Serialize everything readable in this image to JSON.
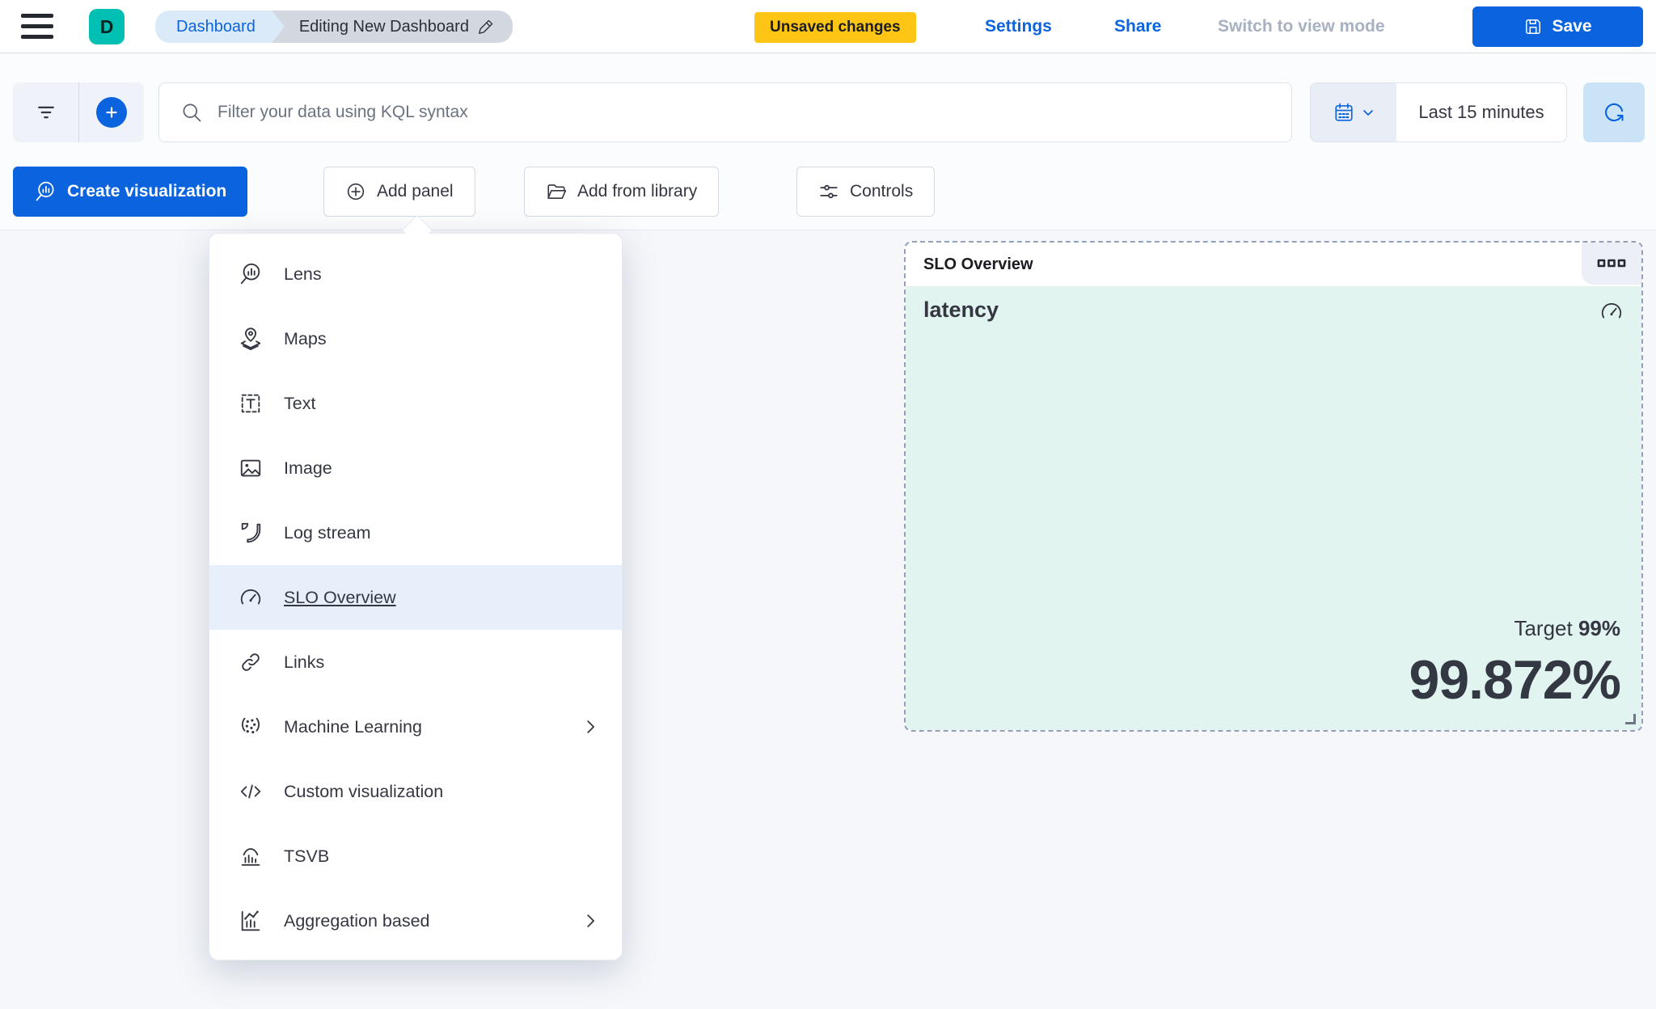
{
  "header": {
    "avatar_initial": "D",
    "breadcrumbs": [
      {
        "label": "Dashboard"
      },
      {
        "label": "Editing New Dashboard"
      }
    ],
    "unsaved_badge": "Unsaved changes",
    "settings_label": "Settings",
    "share_label": "Share",
    "view_mode_label": "Switch to view mode",
    "save_label": "Save"
  },
  "filter_bar": {
    "search_placeholder": "Filter your data using KQL syntax",
    "time_range": "Last 15 minutes"
  },
  "toolbar": {
    "create_visualization_label": "Create visualization",
    "add_panel_label": "Add panel",
    "add_from_library_label": "Add from library",
    "controls_label": "Controls"
  },
  "add_panel_menu": {
    "items": [
      {
        "label": "Lens",
        "icon": "lens-icon",
        "highlighted": false,
        "has_submenu": false
      },
      {
        "label": "Maps",
        "icon": "maps-icon",
        "highlighted": false,
        "has_submenu": false
      },
      {
        "label": "Text",
        "icon": "text-icon",
        "highlighted": false,
        "has_submenu": false
      },
      {
        "label": "Image",
        "icon": "image-icon",
        "highlighted": false,
        "has_submenu": false
      },
      {
        "label": "Log stream",
        "icon": "log-stream-icon",
        "highlighted": false,
        "has_submenu": false
      },
      {
        "label": "SLO Overview",
        "icon": "slo-gauge-icon",
        "highlighted": true,
        "has_submenu": false
      },
      {
        "label": "Links",
        "icon": "link-icon",
        "highlighted": false,
        "has_submenu": false
      },
      {
        "label": "Machine Learning",
        "icon": "machine-learning-icon",
        "highlighted": false,
        "has_submenu": true
      },
      {
        "label": "Custom visualization",
        "icon": "code-icon",
        "highlighted": false,
        "has_submenu": false
      },
      {
        "label": "TSVB",
        "icon": "tsvb-icon",
        "highlighted": false,
        "has_submenu": false
      },
      {
        "label": "Aggregation based",
        "icon": "aggregation-icon",
        "highlighted": false,
        "has_submenu": true
      }
    ]
  },
  "slo_panel": {
    "title": "SLO Overview",
    "slo_name": "latency",
    "target_label": "Target",
    "target_value": "99%",
    "value": "99.872%"
  },
  "colors": {
    "primary_blue": "#0B64DD",
    "warning_badge_yellow": "#FEC514",
    "avatar_teal": "#00BFB3",
    "panel_mint": "#E1F4F0",
    "menu_highlight_blue": "#E7F0FA",
    "dashed_border_gray": "#94A0B8"
  }
}
